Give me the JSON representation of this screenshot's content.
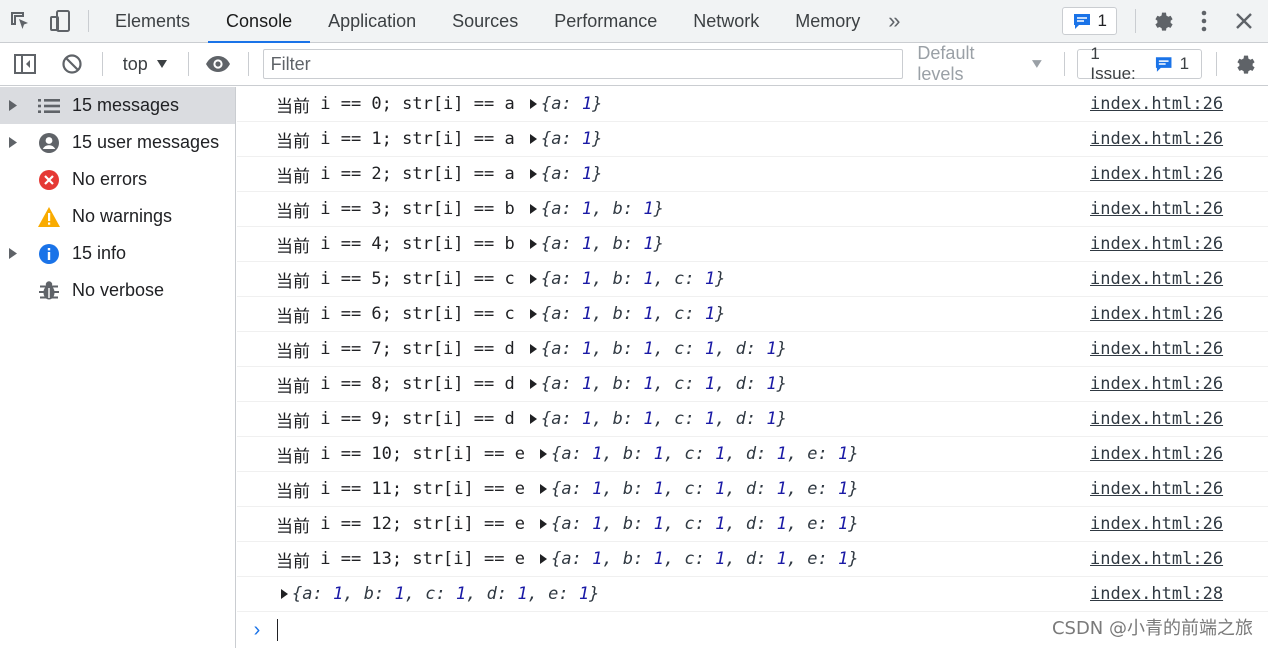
{
  "tabs": [
    "Elements",
    "Console",
    "Application",
    "Sources",
    "Performance",
    "Network",
    "Memory"
  ],
  "active_tab": "Console",
  "more_tabs_glyph": "»",
  "messages_badge": "1",
  "toolbar": {
    "context": "top",
    "filter_placeholder": "Filter",
    "levels": "Default levels",
    "issue_label": "1 Issue:",
    "issue_count": "1"
  },
  "sidebar": {
    "items": [
      {
        "label": "15 messages",
        "icon": "list-icon",
        "has_arrow": true
      },
      {
        "label": "15 user messages",
        "icon": "user-icon",
        "has_arrow": true
      },
      {
        "label": "No errors",
        "icon": "error-icon",
        "has_arrow": false
      },
      {
        "label": "No warnings",
        "icon": "warning-icon",
        "has_arrow": false
      },
      {
        "label": "15 info",
        "icon": "info-icon",
        "has_arrow": true
      },
      {
        "label": "No verbose",
        "icon": "bug-icon",
        "has_arrow": false
      }
    ]
  },
  "log": {
    "rows": [
      {
        "prefix": "当前",
        "text": " i == 0; str[i] == a ",
        "obj": [
          [
            "a",
            "1"
          ]
        ],
        "source": "index.html:26"
      },
      {
        "prefix": "当前",
        "text": " i == 1; str[i] == a ",
        "obj": [
          [
            "a",
            "1"
          ]
        ],
        "source": "index.html:26"
      },
      {
        "prefix": "当前",
        "text": " i == 2; str[i] == a ",
        "obj": [
          [
            "a",
            "1"
          ]
        ],
        "source": "index.html:26"
      },
      {
        "prefix": "当前",
        "text": " i == 3; str[i] == b ",
        "obj": [
          [
            "a",
            "1"
          ],
          [
            "b",
            "1"
          ]
        ],
        "source": "index.html:26"
      },
      {
        "prefix": "当前",
        "text": " i == 4; str[i] == b ",
        "obj": [
          [
            "a",
            "1"
          ],
          [
            "b",
            "1"
          ]
        ],
        "source": "index.html:26"
      },
      {
        "prefix": "当前",
        "text": " i == 5; str[i] == c ",
        "obj": [
          [
            "a",
            "1"
          ],
          [
            "b",
            "1"
          ],
          [
            "c",
            "1"
          ]
        ],
        "source": "index.html:26"
      },
      {
        "prefix": "当前",
        "text": " i == 6; str[i] == c ",
        "obj": [
          [
            "a",
            "1"
          ],
          [
            "b",
            "1"
          ],
          [
            "c",
            "1"
          ]
        ],
        "source": "index.html:26"
      },
      {
        "prefix": "当前",
        "text": " i == 7; str[i] == d ",
        "obj": [
          [
            "a",
            "1"
          ],
          [
            "b",
            "1"
          ],
          [
            "c",
            "1"
          ],
          [
            "d",
            "1"
          ]
        ],
        "source": "index.html:26"
      },
      {
        "prefix": "当前",
        "text": " i == 8; str[i] == d ",
        "obj": [
          [
            "a",
            "1"
          ],
          [
            "b",
            "1"
          ],
          [
            "c",
            "1"
          ],
          [
            "d",
            "1"
          ]
        ],
        "source": "index.html:26"
      },
      {
        "prefix": "当前",
        "text": " i == 9; str[i] == d ",
        "obj": [
          [
            "a",
            "1"
          ],
          [
            "b",
            "1"
          ],
          [
            "c",
            "1"
          ],
          [
            "d",
            "1"
          ]
        ],
        "source": "index.html:26"
      },
      {
        "prefix": "当前",
        "text": " i == 10; str[i] == e ",
        "obj": [
          [
            "a",
            "1"
          ],
          [
            "b",
            "1"
          ],
          [
            "c",
            "1"
          ],
          [
            "d",
            "1"
          ],
          [
            "e",
            "1"
          ]
        ],
        "source": "index.html:26"
      },
      {
        "prefix": "当前",
        "text": " i == 11; str[i] == e ",
        "obj": [
          [
            "a",
            "1"
          ],
          [
            "b",
            "1"
          ],
          [
            "c",
            "1"
          ],
          [
            "d",
            "1"
          ],
          [
            "e",
            "1"
          ]
        ],
        "source": "index.html:26"
      },
      {
        "prefix": "当前",
        "text": " i == 12; str[i] == e ",
        "obj": [
          [
            "a",
            "1"
          ],
          [
            "b",
            "1"
          ],
          [
            "c",
            "1"
          ],
          [
            "d",
            "1"
          ],
          [
            "e",
            "1"
          ]
        ],
        "source": "index.html:26"
      },
      {
        "prefix": "当前",
        "text": " i == 13; str[i] == e ",
        "obj": [
          [
            "a",
            "1"
          ],
          [
            "b",
            "1"
          ],
          [
            "c",
            "1"
          ],
          [
            "d",
            "1"
          ],
          [
            "e",
            "1"
          ]
        ],
        "source": "index.html:26"
      },
      {
        "prefix": "",
        "text": "",
        "obj": [
          [
            "a",
            "1"
          ],
          [
            "b",
            "1"
          ],
          [
            "c",
            "1"
          ],
          [
            "d",
            "1"
          ],
          [
            "e",
            "1"
          ]
        ],
        "source": "index.html:28"
      }
    ]
  },
  "prompt_glyph": "›",
  "watermark": "CSDN @小青的前端之旅",
  "colors": {
    "accent": "#1a73e8",
    "error": "#e53935",
    "warning": "#f9ab00",
    "info": "#1a73e8",
    "number": "#1a1aa6"
  }
}
